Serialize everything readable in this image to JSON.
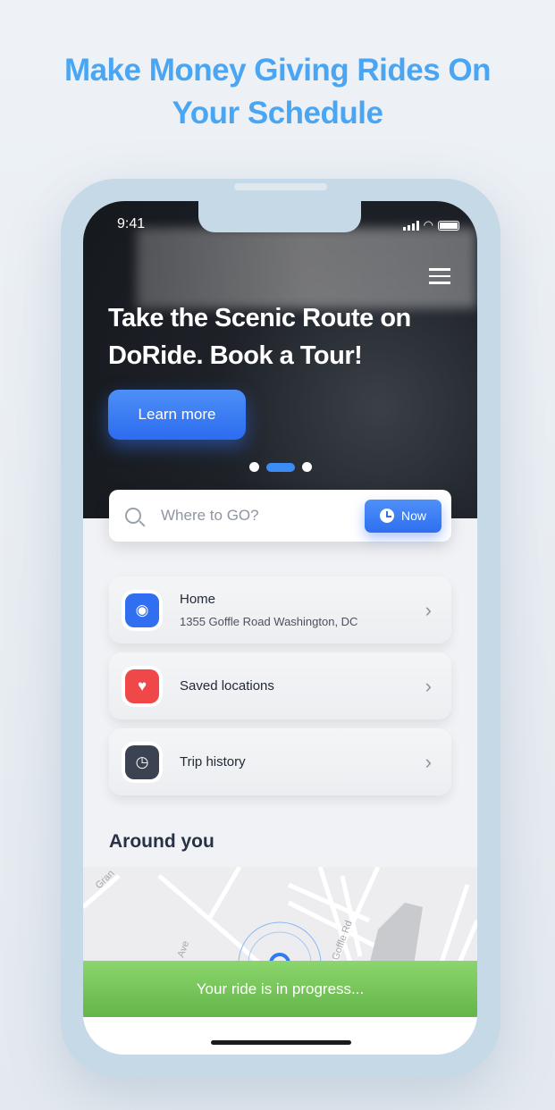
{
  "headline": {
    "line1": "Make Money Giving Rides On",
    "line2": "Your Schedule"
  },
  "status_bar": {
    "time": "9:41"
  },
  "hero": {
    "title": "Take the Scenic Route on DoRide. Book a Tour!",
    "button": "Learn more",
    "slides": 3,
    "active_slide": 2
  },
  "search": {
    "placeholder": "Where to GO?",
    "now_label": "Now"
  },
  "places": [
    {
      "title": "Home",
      "subtitle": "1355 Goffle Road Washington, DC",
      "icon": "location-pin-icon",
      "color": "#2f6ff0"
    },
    {
      "title": "Saved locations",
      "icon": "heart-icon",
      "color": "#f04848"
    },
    {
      "title": "Trip history",
      "icon": "clock-icon",
      "color": "#3b4352"
    }
  ],
  "around": {
    "title": "Around you",
    "map_labels": [
      "Gran",
      "Ave",
      "Goffle Rd"
    ]
  },
  "progress_banner": "Your ride is in progress...",
  "colors": {
    "accent": "#2f6ff0",
    "success": "#6cbc50",
    "headline": "#4aa6f3"
  }
}
